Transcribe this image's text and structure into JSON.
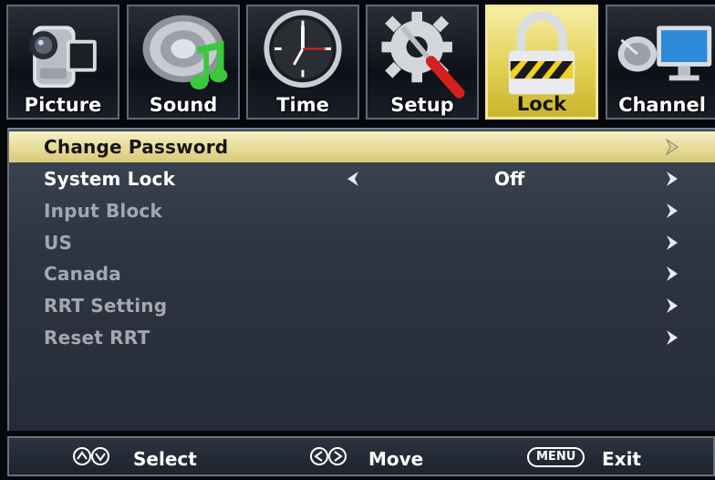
{
  "tabs": [
    {
      "label": "Picture",
      "icon": "camcorder-icon",
      "active": false
    },
    {
      "label": "Sound",
      "icon": "speaker-music-icon",
      "active": false
    },
    {
      "label": "Time",
      "icon": "clock-icon",
      "active": false
    },
    {
      "label": "Setup",
      "icon": "gear-screwdriver-icon",
      "active": false
    },
    {
      "label": "Lock",
      "icon": "padlock-icon",
      "active": true
    },
    {
      "label": "Channel",
      "icon": "satellite-monitor-icon",
      "active": false
    }
  ],
  "menu": {
    "items": [
      {
        "label": "Change Password",
        "state": "selected"
      },
      {
        "label": "System Lock",
        "state": "enabled",
        "value": "Off"
      },
      {
        "label": "Input Block",
        "state": "disabled"
      },
      {
        "label": "US",
        "state": "disabled"
      },
      {
        "label": "Canada",
        "state": "disabled"
      },
      {
        "label": "RRT Setting",
        "state": "disabled"
      },
      {
        "label": "Reset RRT",
        "state": "disabled"
      }
    ]
  },
  "footer": {
    "select_label": "Select",
    "move_label": "Move",
    "menu_key": "MENU",
    "exit_label": "Exit"
  },
  "colors": {
    "active_tab": "#e2d053",
    "selected_row": "#e8dc98",
    "panel": "#2e3542",
    "disabled_text": "#a3a8b0"
  }
}
